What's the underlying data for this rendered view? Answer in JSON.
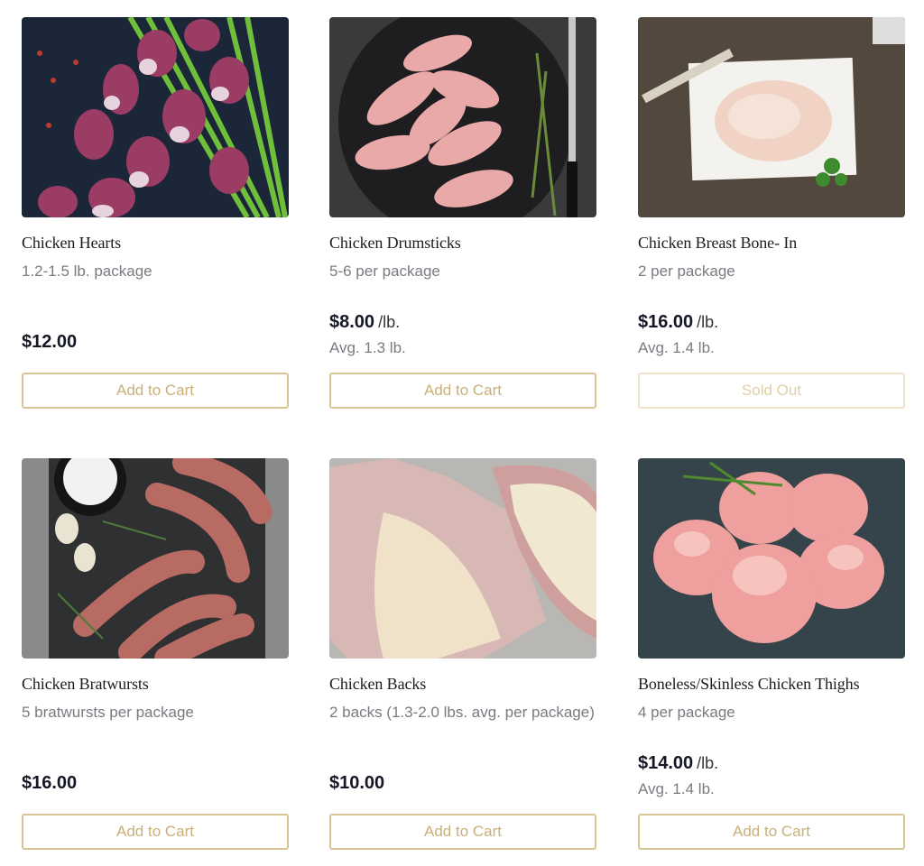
{
  "products": [
    {
      "title": "Chicken Hearts",
      "description": "1.2-1.5 lb. package",
      "price": "$12.00",
      "unit": "",
      "avg": "",
      "button": "Add to Cart",
      "sold_out": false,
      "image": "chicken-hearts-photo"
    },
    {
      "title": "Chicken Drumsticks",
      "description": "5-6 per package",
      "price": "$8.00",
      "unit": "/lb.",
      "avg": "Avg. 1.3 lb.",
      "button": "Add to Cart",
      "sold_out": false,
      "image": "chicken-drumsticks-photo"
    },
    {
      "title": "Chicken Breast Bone- In",
      "description": "2 per package",
      "price": "$16.00",
      "unit": "/lb.",
      "avg": "Avg. 1.4 lb.",
      "button": "Sold Out",
      "sold_out": true,
      "image": "chicken-breast-photo"
    },
    {
      "title": "Chicken Bratwursts",
      "description": "5 bratwursts per package",
      "price": "$16.00",
      "unit": "",
      "avg": "",
      "button": "Add to Cart",
      "sold_out": false,
      "image": "chicken-bratwursts-photo"
    },
    {
      "title": "Chicken Backs",
      "description": "2 backs (1.3-2.0 lbs. avg. per package)",
      "price": "$10.00",
      "unit": "",
      "avg": "",
      "button": "Add to Cart",
      "sold_out": false,
      "image": "chicken-backs-photo"
    },
    {
      "title": "Boneless/Skinless Chicken Thighs",
      "description": "4 per package",
      "price": "$14.00",
      "unit": "/lb.",
      "avg": "Avg. 1.4 lb.",
      "button": "Add to Cart",
      "sold_out": false,
      "image": "chicken-thighs-photo"
    }
  ],
  "colors": {
    "button_border": "#d8c596",
    "button_text": "#c9b078",
    "sold_out_text": "#dfd0aa",
    "price": "#151824",
    "muted": "#7a7a82"
  }
}
